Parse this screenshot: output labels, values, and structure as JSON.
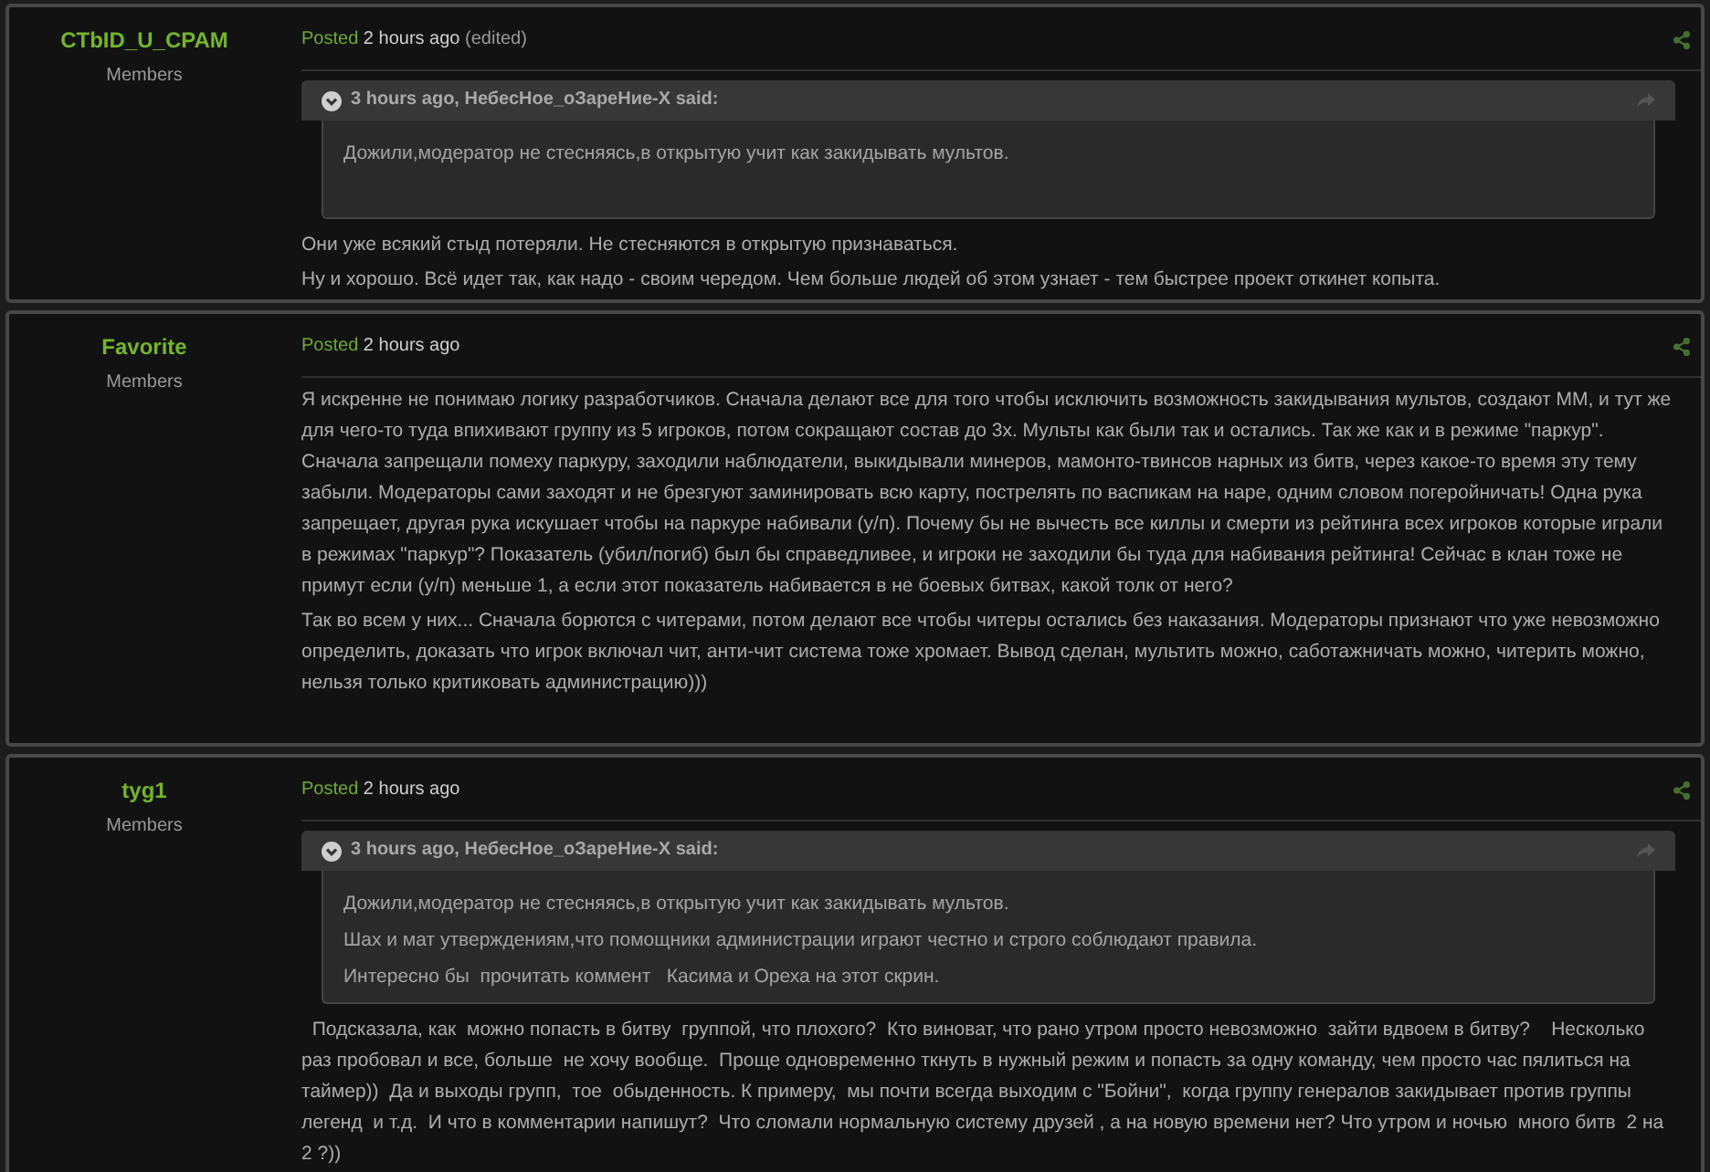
{
  "posts": [
    {
      "author": "CTbID_U_CPAM",
      "group": "Members",
      "posted_label": "Posted",
      "time": "2 hours ago",
      "edited": "(edited)",
      "quote": {
        "citation": "3 hours ago, НебесНое_оЗареНие-X said:",
        "lines": [
          "Дожили,модератор не стесняясь,в открытую учит как закидывать мультов."
        ]
      },
      "paragraphs": [
        "Они уже всякий стыд потеряли. Не стесняются в открытую признаваться.",
        "Ну и хорошо. Всё идет так, как надо - своим чередом. Чем больше людей об этом узнает - тем быстрее проект откинет копыта."
      ]
    },
    {
      "author": "Favorite",
      "group": "Members",
      "posted_label": "Posted",
      "time": "2 hours ago",
      "paragraphs": [
        "Я искренне не понимаю логику разработчиков. Сначала делают все для того чтобы исключить возможность закидывания мультов, создают ММ, и тут же для чего-то туда впихивают группу из 5 игроков, потом сокращают состав до 3х. Мульты как были так и остались. Так же как и в режиме \"паркур\". Сначала запрещали помеху паркуру, заходили наблюдатели, выкидывали минеров, мамонто-твинсов нарных из битв, через какое-то время эту тему забыли. Модераторы сами заходят и не брезгуют заминировать всю карту, пострелять по васпикам на наре, одним словом погеройничать! Одна рука запрещает, другая рука искушает чтобы на паркуре набивали (у/п). Почему бы не вычесть все киллы и смерти из рейтинга всех игроков которые играли в режимах \"паркур\"? Показатель (убил/погиб) был бы справедливее, и игроки не заходили бы туда для набивания рейтинга! Сейчас в клан тоже не примут если (у/п) меньше 1, а если этот показатель набивается в не боевых битвах, какой толк от него?",
        "Так во всем у них... Сначала борются с читерами, потом делают все чтобы читеры остались без наказания. Модераторы признают что уже невозможно определить, доказать что игрок включал чит, анти-чит система тоже хромает. Вывод сделан, мультить можно, саботажничать можно, читерить можно, нельзя только критиковать администрацию)))"
      ]
    },
    {
      "author": "tyg1",
      "group": "Members",
      "posted_label": "Posted",
      "time": "2 hours ago",
      "quote": {
        "citation": "3 hours ago, НебесНое_оЗареНие-X said:",
        "lines": [
          "Дожили,модератор не стесняясь,в открытую учит как закидывать мультов.",
          "Шах и мат утверждениям,что помощники администрации играют честно и строго соблюдают правила.",
          "Интересно бы  прочитать коммент   Касима и Ореха на этот скрин."
        ]
      },
      "paragraphs": [
        "  Подсказала, как  можно попасть в битву  группой, что плохого?  Кто виноват, что рано утром просто невозможно  зайти вдвоем в битву?    Несколько раз пробовал и все, больше  не хочу вообще.  Проще одновременно ткнуть в нужный режим и попасть за одну команду, чем просто час пялиться на таймер))  Да и выходы групп,  тое  обыденность. К примеру,  мы почти всегда выходим с \"Бойни\",  когда группу генералов закидывает против группы легенд  и т.д.  И что в комментарии напишут?  Что сломали нормальную систему друзей , а на новую времени нет? Что утром и ночью  много битв  2 на 2 ?))"
      ]
    }
  ]
}
